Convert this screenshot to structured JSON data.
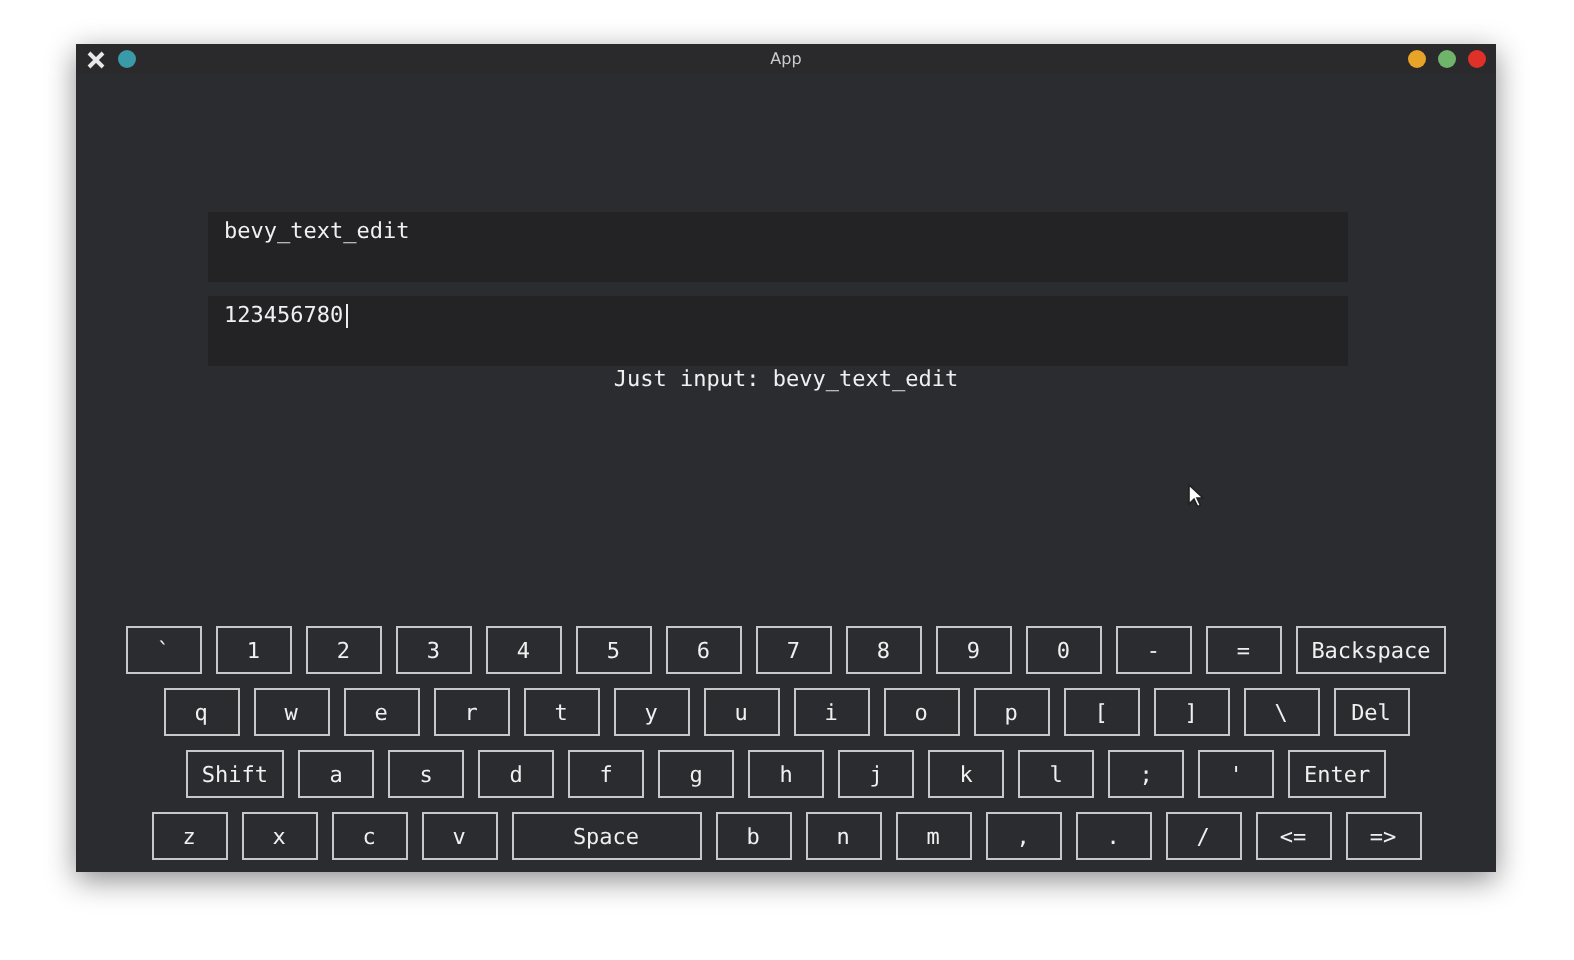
{
  "window": {
    "title": "App"
  },
  "fields": [
    {
      "value": "bevy_text_edit",
      "focused": false
    },
    {
      "value": "123456780",
      "focused": true
    }
  ],
  "status": "Just input: bevy_text_edit",
  "keyboard": [
    [
      {
        "label": "`",
        "kind": "key"
      },
      {
        "label": "1",
        "kind": "key"
      },
      {
        "label": "2",
        "kind": "key"
      },
      {
        "label": "3",
        "kind": "key"
      },
      {
        "label": "4",
        "kind": "key"
      },
      {
        "label": "5",
        "kind": "key"
      },
      {
        "label": "6",
        "kind": "key"
      },
      {
        "label": "7",
        "kind": "key"
      },
      {
        "label": "8",
        "kind": "key"
      },
      {
        "label": "9",
        "kind": "key"
      },
      {
        "label": "0",
        "kind": "key"
      },
      {
        "label": "-",
        "kind": "key"
      },
      {
        "label": "=",
        "kind": "key"
      },
      {
        "label": "Backspace",
        "kind": "key"
      }
    ],
    [
      {
        "label": "q",
        "kind": "key"
      },
      {
        "label": "w",
        "kind": "key"
      },
      {
        "label": "e",
        "kind": "key"
      },
      {
        "label": "r",
        "kind": "key"
      },
      {
        "label": "t",
        "kind": "key"
      },
      {
        "label": "y",
        "kind": "key"
      },
      {
        "label": "u",
        "kind": "key"
      },
      {
        "label": "i",
        "kind": "key"
      },
      {
        "label": "o",
        "kind": "key"
      },
      {
        "label": "p",
        "kind": "key"
      },
      {
        "label": "[",
        "kind": "key"
      },
      {
        "label": "]",
        "kind": "key"
      },
      {
        "label": "\\",
        "kind": "key"
      },
      {
        "label": "Del",
        "kind": "key"
      }
    ],
    [
      {
        "label": "Shift",
        "kind": "key"
      },
      {
        "label": "a",
        "kind": "key"
      },
      {
        "label": "s",
        "kind": "key"
      },
      {
        "label": "d",
        "kind": "key"
      },
      {
        "label": "f",
        "kind": "key"
      },
      {
        "label": "g",
        "kind": "key"
      },
      {
        "label": "h",
        "kind": "key"
      },
      {
        "label": "j",
        "kind": "key"
      },
      {
        "label": "k",
        "kind": "key"
      },
      {
        "label": "l",
        "kind": "key"
      },
      {
        "label": ";",
        "kind": "key"
      },
      {
        "label": "'",
        "kind": "key"
      },
      {
        "label": "Enter",
        "kind": "key"
      }
    ],
    [
      {
        "label": "z",
        "kind": "key"
      },
      {
        "label": "x",
        "kind": "key"
      },
      {
        "label": "c",
        "kind": "key"
      },
      {
        "label": "v",
        "kind": "key"
      },
      {
        "label": "Space",
        "kind": "space"
      },
      {
        "label": "b",
        "kind": "key"
      },
      {
        "label": "n",
        "kind": "key"
      },
      {
        "label": "m",
        "kind": "key"
      },
      {
        "label": ",",
        "kind": "key"
      },
      {
        "label": ".",
        "kind": "key"
      },
      {
        "label": "/",
        "kind": "key"
      },
      {
        "label": "<=",
        "kind": "key"
      },
      {
        "label": "=>",
        "kind": "key"
      }
    ]
  ]
}
